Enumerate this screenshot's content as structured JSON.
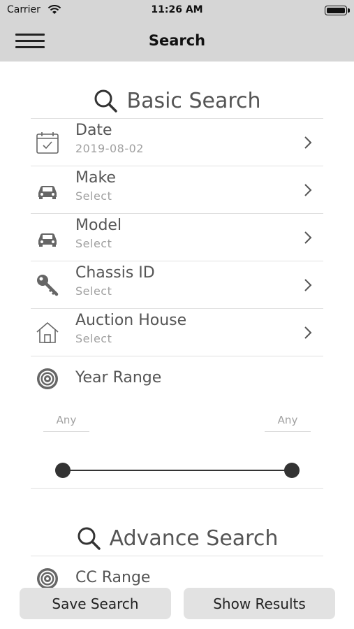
{
  "status_bar": {
    "carrier": "Carrier",
    "time": "11:26 AM"
  },
  "nav": {
    "title": "Search"
  },
  "basic_search": {
    "title": "Basic Search",
    "rows": [
      {
        "title": "Date",
        "value": "2019-08-02",
        "icon": "calendar-icon"
      },
      {
        "title": "Make",
        "value": "Select",
        "icon": "car-icon"
      },
      {
        "title": "Model",
        "value": "Select",
        "icon": "car-icon"
      },
      {
        "title": "Chassis ID",
        "value": "Select",
        "icon": "key-icon"
      },
      {
        "title": "Auction House",
        "value": "Select",
        "icon": "house-icon"
      }
    ],
    "year_range": {
      "label": "Year Range",
      "min_label": "Any",
      "max_label": "Any",
      "icon": "target-icon"
    }
  },
  "advance_search": {
    "title": "Advance Search",
    "cc_range": {
      "label": "CC Range",
      "icon": "target-icon"
    }
  },
  "buttons": {
    "save": "Save Search",
    "show": "Show Results"
  }
}
